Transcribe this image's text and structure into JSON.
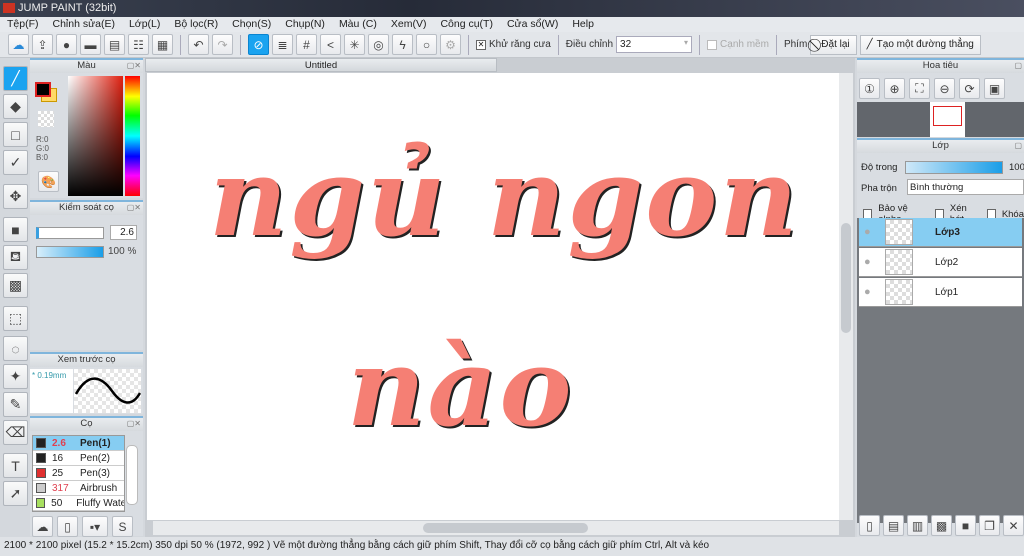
{
  "app": {
    "title": "JUMP PAINT (32bit)"
  },
  "menu": [
    "Tệp(F)",
    "Chỉnh sửa(E)",
    "Lớp(L)",
    "Bộ lọc(R)",
    "Chọn(S)",
    "Chụp(N)",
    "Màu (C)",
    "Xem(V)",
    "Công cụ(T)",
    "Cửa sổ(W)",
    "Help"
  ],
  "toolbar": {
    "antialias_label": "Khử răng cưa",
    "antialias_checked": true,
    "adjust_label": "Điều chỉnh",
    "adjust_value": "32",
    "smooth_label": "Cạnh mềm",
    "key_label": "Phím",
    "reset_label": "Đặt lại",
    "line_label": "Tạo một đường thẳng"
  },
  "color_panel": {
    "title": "Màu",
    "r": "R:0",
    "g": "G:0",
    "b": "B:0",
    "primary": "#000000",
    "secondary": "#ffd966"
  },
  "brush_control": {
    "title": "Kiểm soát cọ",
    "size": "2.6",
    "opacity": "100 %"
  },
  "brush_preview": {
    "title": "Xem trước cọ",
    "size": "* 0.19mm"
  },
  "brushes": {
    "title": "Cọ",
    "items": [
      {
        "size": "2.6",
        "name": "Pen(1)",
        "color": "#222222",
        "selected": true,
        "size_color": "#e04050"
      },
      {
        "size": "16",
        "name": "Pen(2)",
        "color": "#222222",
        "size_color": "#222222"
      },
      {
        "size": "25",
        "name": "Pen(3)",
        "color": "#e03030",
        "size_color": "#222222"
      },
      {
        "size": "317",
        "name": "Airbrush",
        "color": "#cccccc",
        "size_color": "#e04050"
      },
      {
        "size": "50",
        "name": "Fluffy Water",
        "color": "#a8e060",
        "size_color": "#222222"
      }
    ]
  },
  "document": {
    "tab": "Untitled",
    "text_line1": "ngủ ngon",
    "text_line2": "nào"
  },
  "navigator": {
    "title": "Hoa tiêu"
  },
  "layers": {
    "title": "Lớp",
    "opacity_label": "Độ trong",
    "opacity_value": "100",
    "blend_label": "Pha trộn",
    "blend_value": "Bình thường",
    "protect_alpha": "Bảo vệ alpha",
    "clip": "Xén bớt",
    "lock": "Khóa",
    "items": [
      {
        "name": "Lớp3",
        "selected": true
      },
      {
        "name": "Lớp2"
      },
      {
        "name": "Lớp1"
      }
    ]
  },
  "status": "2100 * 2100 pixel   (15.2 * 15.2cm)   350 dpi   50 %   (1972, 992 )   Vẽ một đường thẳng bằng cách giữ phím Shift, Thay đổi cỡ cọ bằng cách giữ phím Ctrl, Alt và kéo"
}
